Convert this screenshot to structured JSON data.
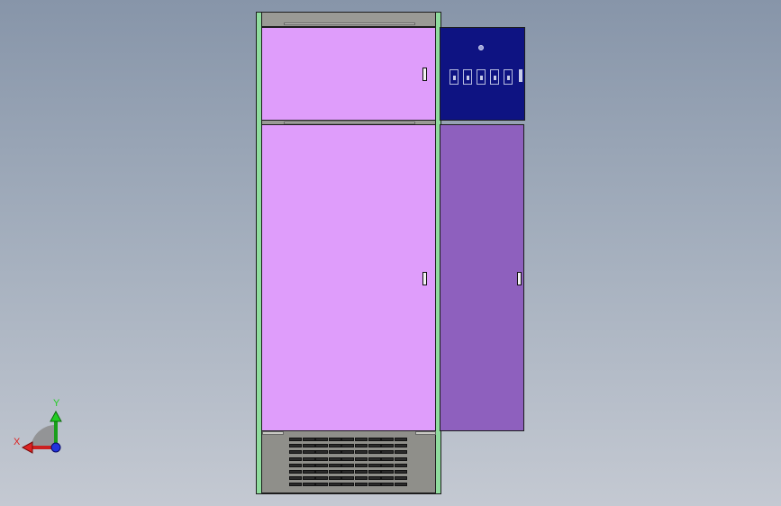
{
  "viewport": {
    "background": "#97a3b4"
  },
  "cabinet": {
    "door_color": "#df9dfb",
    "frame_color": "#8fdc9d",
    "side_door_color": "#8e60be",
    "control_panel_color": "#0e1382",
    "base_color": "#8f8f8a",
    "louver_rows": 8,
    "louver_cols": 9,
    "panel_switch_count": 5
  },
  "triad": {
    "y_label": "Y",
    "x_label": "X",
    "y_color": "#22cc22",
    "x_color": "#dd2222",
    "z_color": "#2233dd"
  }
}
